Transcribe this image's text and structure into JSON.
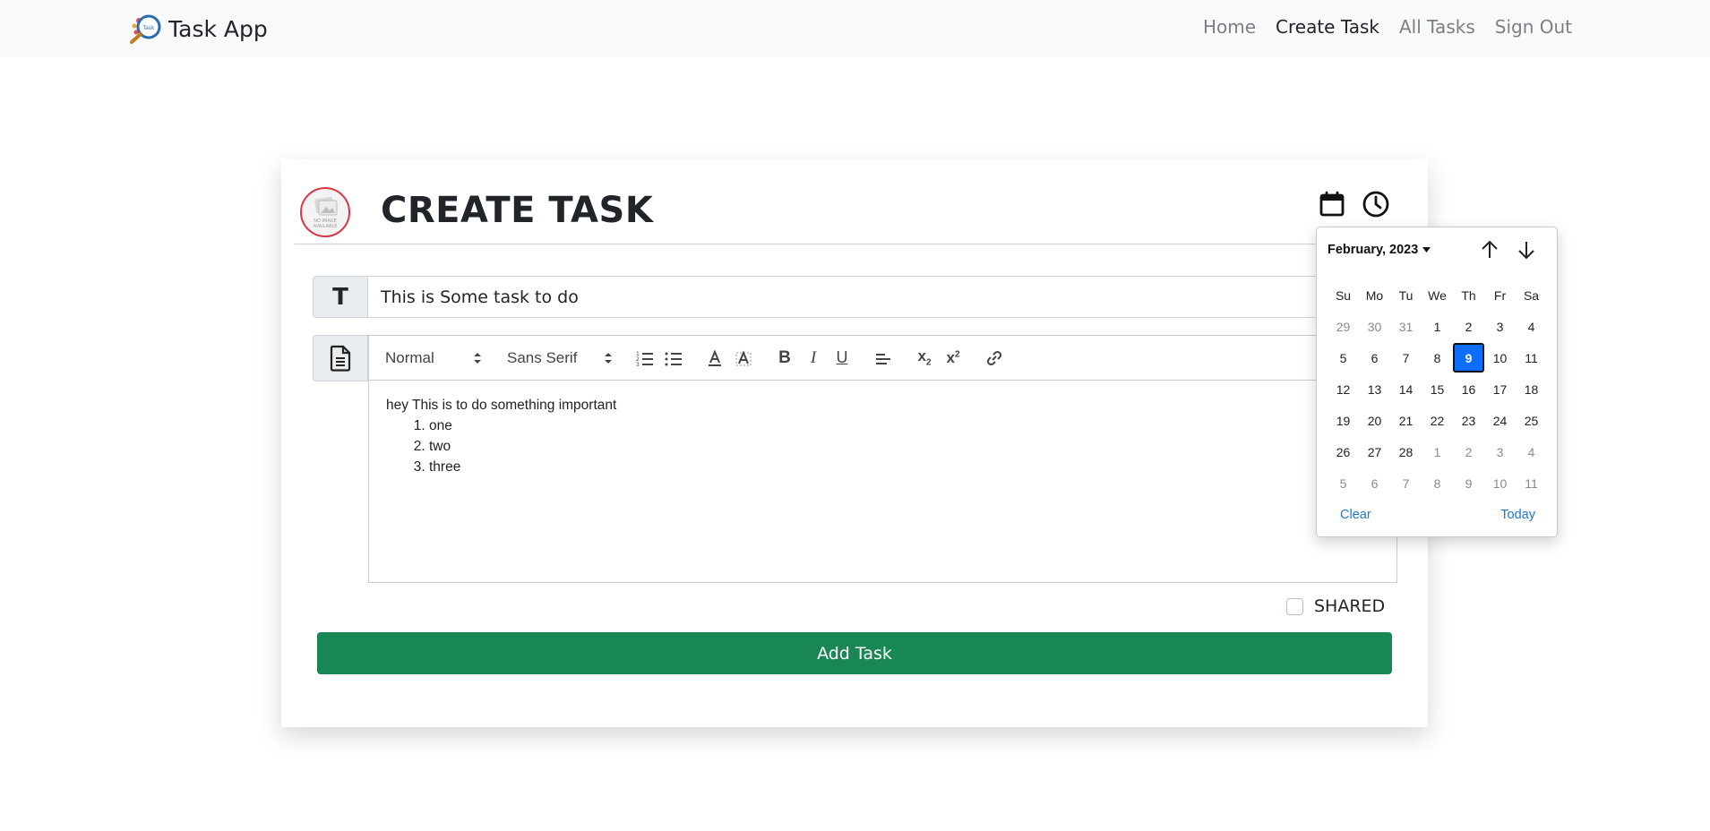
{
  "app": {
    "title": "Task App"
  },
  "nav": {
    "items": [
      "Home",
      "Create Task",
      "All Tasks",
      "Sign Out"
    ],
    "active": "Create Task"
  },
  "card": {
    "title": "CREATE TASK",
    "avatar_text": "NO IMAGE AVAILABLE",
    "task_title_value": "This is Some task to do",
    "editor": {
      "header_select": "Normal",
      "font_select": "Sans Serif",
      "body_line": "hey This is to do something important",
      "list_items": [
        "one",
        "two",
        "three"
      ]
    },
    "shared_label": "SHARED",
    "shared_checked": false,
    "submit_label": "Add Task"
  },
  "datepicker": {
    "month_label": "February, 2023",
    "weekdays": [
      "Su",
      "Mo",
      "Tu",
      "We",
      "Th",
      "Fr",
      "Sa"
    ],
    "weeks": [
      [
        "29",
        "30",
        "31",
        "1",
        "2",
        "3",
        "4"
      ],
      [
        "5",
        "6",
        "7",
        "8",
        "9",
        "10",
        "11"
      ],
      [
        "12",
        "13",
        "14",
        "15",
        "16",
        "17",
        "18"
      ],
      [
        "19",
        "20",
        "21",
        "22",
        "23",
        "24",
        "25"
      ],
      [
        "26",
        "27",
        "28",
        "1",
        "2",
        "3",
        "4"
      ],
      [
        "5",
        "6",
        "7",
        "8",
        "9",
        "10",
        "11"
      ]
    ],
    "selected_day": "9",
    "clear_label": "Clear",
    "today_label": "Today"
  },
  "colors": {
    "primary": "#0d6efd",
    "success": "#198754",
    "link": "#1f78c8",
    "avatar_border": "#dc3545"
  }
}
